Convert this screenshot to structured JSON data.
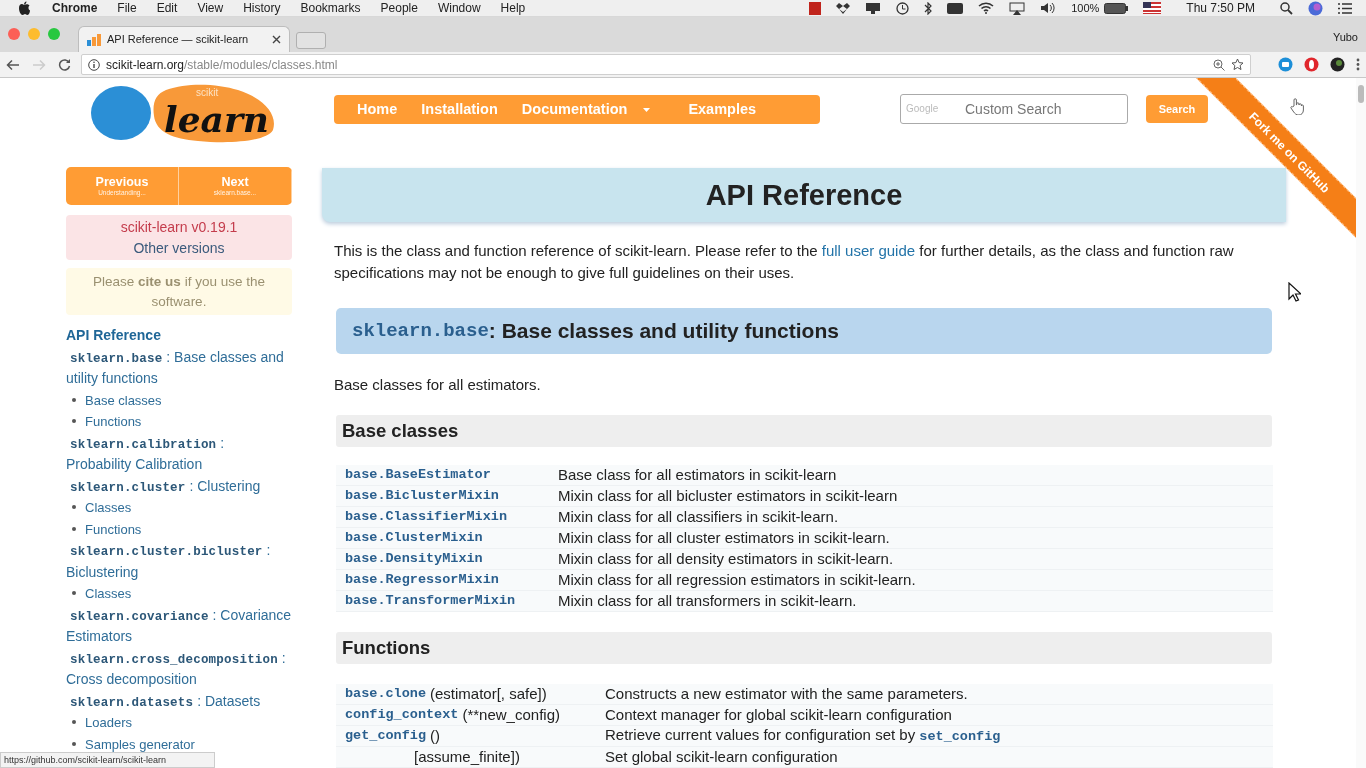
{
  "menubar": {
    "app": "Chrome",
    "menus": [
      "File",
      "Edit",
      "View",
      "History",
      "Bookmarks",
      "People",
      "Window",
      "Help"
    ],
    "battery": "100%",
    "clock": "Thu 7:50 PM"
  },
  "browser": {
    "tabs": [
      {
        "title": "API Reference — scikit-learn",
        "selected": true
      }
    ],
    "profile": "Yubo",
    "url_host": "scikit-learn.org",
    "url_path": "/stable/modules/classes.html",
    "status_url": "https://github.com/scikit-learn/scikit-learn"
  },
  "logo": {
    "small": "scikit",
    "big": "learn"
  },
  "nav": [
    {
      "label": "Home",
      "dropdown": false
    },
    {
      "label": "Installation",
      "dropdown": false
    },
    {
      "label": "Documentation",
      "dropdown": true
    },
    {
      "label": "Examples",
      "dropdown": false
    }
  ],
  "search": {
    "brand": "Google",
    "placeholder": "Custom Search",
    "button": "Search"
  },
  "ribbon": "Fork me on GitHub",
  "sidebar": {
    "pager": [
      {
        "label": "Previous",
        "subtitle": "Understanding..."
      },
      {
        "label": "Next",
        "subtitle": "sklearn.base..."
      }
    ],
    "version": {
      "title": "scikit-learn v0.19.1",
      "link": "Other versions"
    },
    "cite": "Please **cite us** if you use the software.",
    "toc_title": "API Reference",
    "toc": [
      {
        "module": "sklearn.base",
        "title": ": Base classes and utility functions",
        "children": [
          {
            "label": "Base classes"
          },
          {
            "label": "Functions"
          }
        ]
      },
      {
        "module": "sklearn.calibration",
        "title": ": Probability Calibration"
      },
      {
        "module": "sklearn.cluster",
        "title": ": Clustering",
        "children": [
          {
            "label": "Classes"
          },
          {
            "label": "Functions"
          }
        ]
      },
      {
        "module": "sklearn.cluster.bicluster",
        "title": ": Biclustering",
        "children": [
          {
            "label": "Classes"
          }
        ]
      },
      {
        "module": "sklearn.covariance",
        "title": ": Covariance Estimators"
      },
      {
        "module": "sklearn.cross_decomposition",
        "title": ": Cross decomposition"
      },
      {
        "module": "sklearn.datasets",
        "title": ": Datasets",
        "children": [
          {
            "label": "Loaders"
          },
          {
            "label": "Samples generator"
          }
        ]
      }
    ]
  },
  "content": {
    "title": "API Reference",
    "intro": {
      "before": "This is the class and function reference of scikit-learn. Please refer to the",
      "link": "full user guide",
      "after": "for further details, as the class and function raw specifications may not be enough to give full guidelines on their uses."
    },
    "section": {
      "module": "sklearn.base",
      "title": ": Base classes and utility functions",
      "summary": "Base classes for all estimators.",
      "groups": [
        {
          "heading": "Base classes",
          "kind": "classes",
          "rows": [
            {
              "name": "base.BaseEstimator",
              "description": "Base class for all estimators in scikit-learn"
            },
            {
              "name": "base.BiclusterMixin",
              "description": "Mixin class for all bicluster estimators in scikit-learn"
            },
            {
              "name": "base.ClassifierMixin",
              "description": "Mixin class for all classifiers in scikit-learn."
            },
            {
              "name": "base.ClusterMixin",
              "description": "Mixin class for all cluster estimators in scikit-learn."
            },
            {
              "name": "base.DensityMixin",
              "description": "Mixin class for all density estimators in scikit-learn."
            },
            {
              "name": "base.RegressorMixin",
              "description": "Mixin class for all regression estimators in scikit-learn."
            },
            {
              "name": "base.TransformerMixin",
              "description": "Mixin class for all transformers in scikit-learn."
            }
          ]
        },
        {
          "heading": "Functions",
          "kind": "functions",
          "rows": [
            {
              "name": "base.clone",
              "signature": "(estimator[, safe])",
              "description": "Constructs a new estimator with the same parameters."
            },
            {
              "name": "config_context",
              "signature": "(**new_config)",
              "description": "Context manager for global scikit-learn configuration"
            },
            {
              "name": "get_config",
              "signature": "()",
              "description": "Retrieve current values for configuration set by",
              "link": "set_config"
            },
            {
              "signature": "[assume_finite])",
              "description": "Set global scikit-learn configuration"
            }
          ]
        }
      ]
    }
  }
}
